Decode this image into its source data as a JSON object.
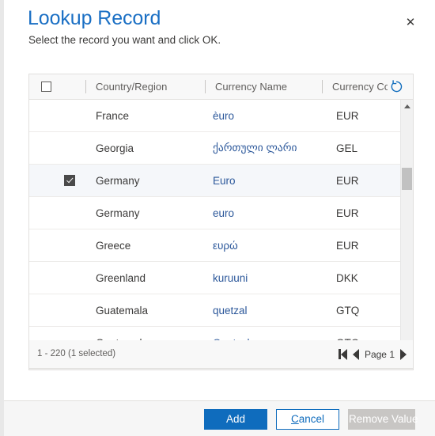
{
  "header": {
    "title": "Lookup Record",
    "subtitle": "Select the record you want and click OK.",
    "close_icon": "close-icon"
  },
  "grid": {
    "select_all_icon": "checkbox-unchecked-icon",
    "refresh_icon": "refresh-icon",
    "columns": [
      {
        "label": "Country/Region"
      },
      {
        "label": "Currency Name"
      },
      {
        "label": "Currency Code"
      }
    ],
    "rows": [
      {
        "selected": false,
        "country": "France",
        "currency_name": "èuro",
        "currency_code": "EUR"
      },
      {
        "selected": false,
        "country": "Georgia",
        "currency_name": "ქართული ლარი",
        "currency_code": "GEL"
      },
      {
        "selected": true,
        "country": "Germany",
        "currency_name": "Euro",
        "currency_code": "EUR"
      },
      {
        "selected": false,
        "country": "Germany",
        "currency_name": "euro",
        "currency_code": "EUR"
      },
      {
        "selected": false,
        "country": "Greece",
        "currency_name": "ευρώ",
        "currency_code": "EUR"
      },
      {
        "selected": false,
        "country": "Greenland",
        "currency_name": "kuruuni",
        "currency_code": "DKK"
      },
      {
        "selected": false,
        "country": "Guatemala",
        "currency_name": "quetzal",
        "currency_code": "GTQ"
      },
      {
        "selected": false,
        "country": "Guatemala",
        "currency_name": "Quetzal",
        "currency_code": "GTQ"
      }
    ],
    "vertical_scrollbar": {
      "up_icon": "scroll-up-arrow-icon",
      "down_icon": "scroll-down-arrow-icon"
    },
    "horizontal_scrollbar": {
      "left_icon": "scroll-left-arrow-icon",
      "right_icon": "scroll-right-arrow-icon"
    }
  },
  "status": {
    "record_count": "1 - 220 (1 selected)",
    "page_label": "Page 1",
    "first_page_icon": "first-page-icon",
    "previous_page_icon": "previous-page-icon",
    "next_page_icon": "next-page-icon"
  },
  "footer": {
    "add_label": "Add",
    "cancel_accesskey": "C",
    "cancel_rest": "ancel",
    "remove_label": "Remove Value"
  }
}
